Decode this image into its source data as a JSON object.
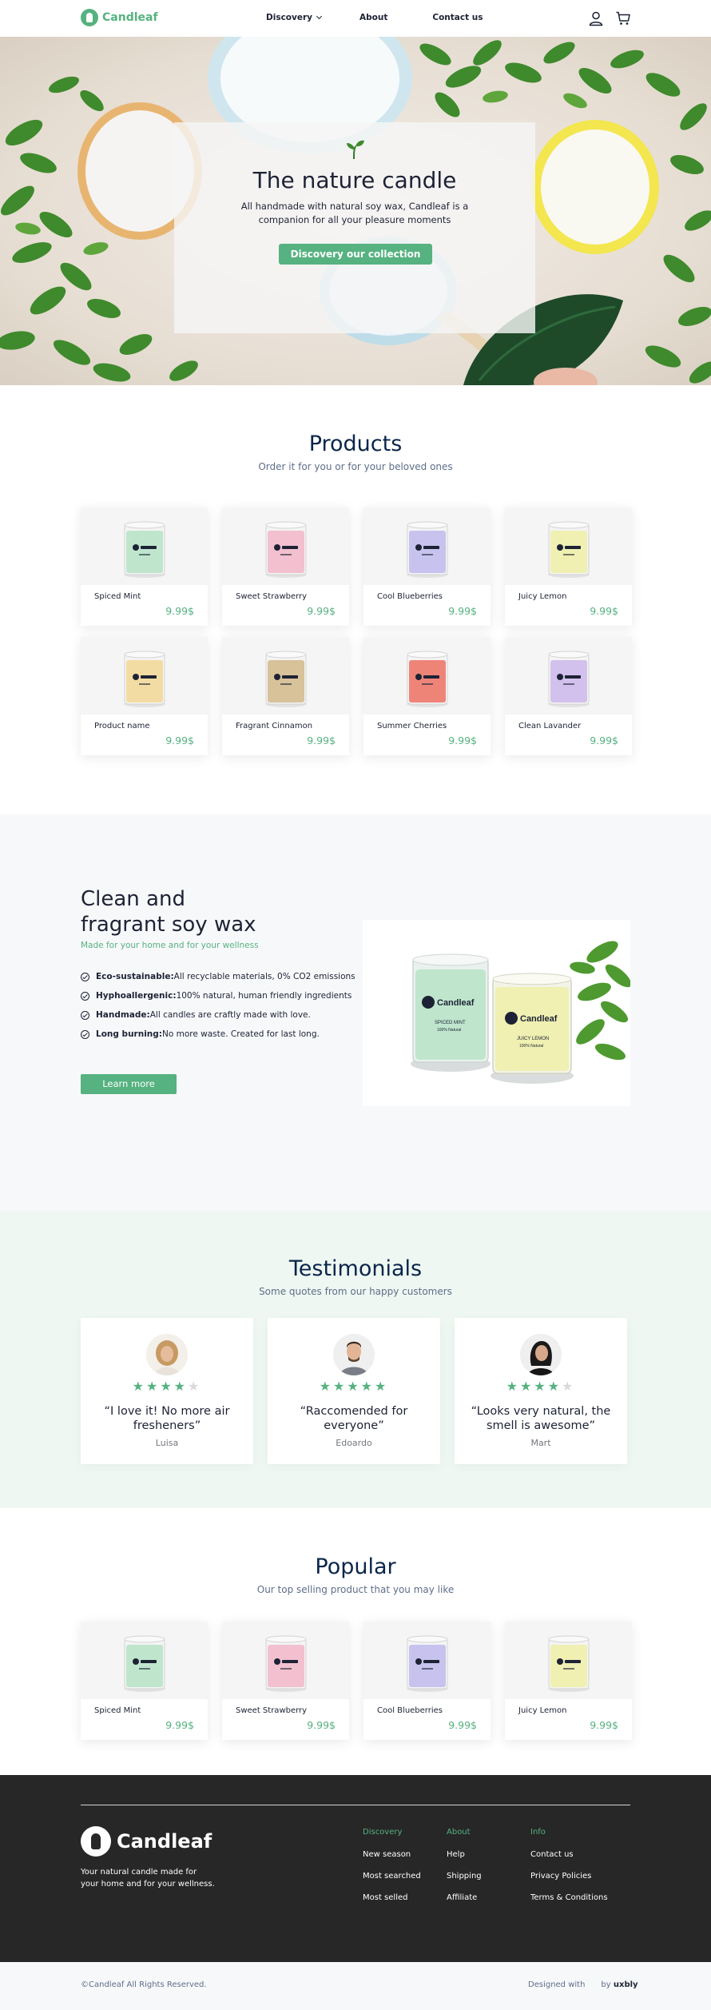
{
  "nav": {
    "logo": "Candleaf",
    "menu": [
      "Discovery",
      "About",
      "Contact us"
    ]
  },
  "hero": {
    "title": "The nature candle",
    "subtitle": "All handmade with natural soy wax, Candleaf is a companion for all your pleasure moments",
    "button": "Discovery our collection"
  },
  "products": {
    "title": "Products",
    "subtitle": "Order it for you or for your beloved ones",
    "items": [
      {
        "name": "Spiced Mint",
        "price": "9.99$",
        "color": "#bfe6cd"
      },
      {
        "name": "Sweet Strawberry",
        "price": "9.99$",
        "color": "#f2c0cf"
      },
      {
        "name": "Cool Blueberries",
        "price": "9.99$",
        "color": "#c7c3ee"
      },
      {
        "name": "Juicy Lemon",
        "price": "9.99$",
        "color": "#eff0b1"
      },
      {
        "name": "Product name",
        "price": "9.99$",
        "color": "#f3dca3"
      },
      {
        "name": "Fragrant Cinnamon",
        "price": "9.99$",
        "color": "#d7c29a"
      },
      {
        "name": "Summer Cherries",
        "price": "9.99$",
        "color": "#ee8478"
      },
      {
        "name": "Clean Lavander",
        "price": "9.99$",
        "color": "#d2c1ec"
      }
    ]
  },
  "features": {
    "title_line1": "Clean and",
    "title_line2": "fragrant soy wax",
    "subtitle": "Made for your home and for your wellness",
    "items": [
      {
        "label": "Eco-sustainable:",
        "text": "All recyclable materials, 0% CO2 emissions"
      },
      {
        "label": "Hyphoallergenic:",
        "text": " 100% natural, human friendly ingredients"
      },
      {
        "label": "Handmade:",
        "text": " All candles are craftly made with love."
      },
      {
        "label": "Long burning:",
        "text": " No more waste. Created for last long."
      }
    ],
    "button": "Learn more",
    "image": {
      "brand": "Candleaf",
      "green_label": "SPICED MINT",
      "green_sub": "100% Natural",
      "yellow_label": "JUICY LEMON",
      "yellow_sub": "100% Natural"
    }
  },
  "testimonials": {
    "title": "Testimonials",
    "subtitle": "Some quotes from our happy customers",
    "items": [
      {
        "quote": "“I love it! No more air fresheners”",
        "name": "Luisa",
        "rating": 4
      },
      {
        "quote": "“Raccomended for everyone”",
        "name": "Edoardo",
        "rating": 5
      },
      {
        "quote": "“Looks very natural, the smell is awesome”",
        "name": "Mart",
        "rating": 4
      }
    ]
  },
  "popular": {
    "title": "Popular",
    "subtitle": "Our top selling product that you may like",
    "items": [
      {
        "name": "Spiced Mint",
        "price": "9.99$",
        "color": "#bfe6cd"
      },
      {
        "name": "Sweet Strawberry",
        "price": "9.99$",
        "color": "#f2c0cf"
      },
      {
        "name": "Cool Blueberries",
        "price": "9.99$",
        "color": "#c7c3ee"
      },
      {
        "name": "Juicy Lemon",
        "price": "9.99$",
        "color": "#eff0b1"
      }
    ]
  },
  "footer": {
    "logo": "Candleaf",
    "tagline": "Your natural candle made for your home and for your wellness.",
    "columns": [
      {
        "heading": "Discovery",
        "links": [
          "New season",
          "Most searched",
          "Most selled"
        ]
      },
      {
        "heading": "About",
        "links": [
          "Help",
          "Shipping",
          "Affiliate"
        ]
      },
      {
        "heading": "Info",
        "links": [
          "Contact us",
          "Privacy Policies",
          "Terms & Conditions"
        ]
      }
    ],
    "copyright": "©Candleaf All Rights Reserved.",
    "designed_with": "Designed with",
    "by": "by",
    "studio": "uxbly"
  },
  "colors": {
    "accent": "#56b280",
    "dark": "#1d2235",
    "footer": "#272727"
  }
}
